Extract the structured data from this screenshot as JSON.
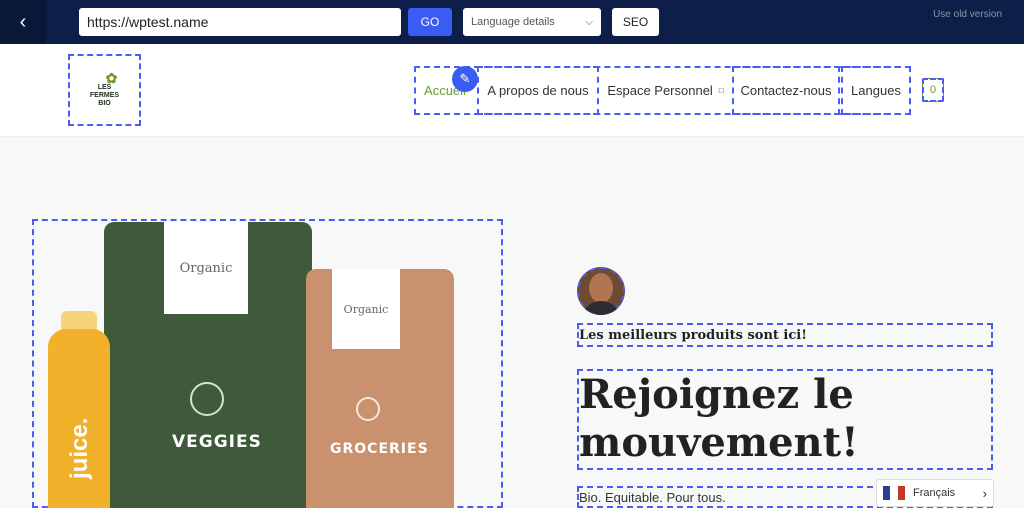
{
  "toolbar": {
    "back_icon": "chevron-left-icon",
    "url_value": "https://wptest.name",
    "go_label": "GO",
    "language_select": "Language details",
    "seo_label": "SEO",
    "old_version_link": "Use old version",
    "accent_color": "#3b5bf5",
    "bar_color": "#0d1f48"
  },
  "site": {
    "logo_lines": [
      "LES",
      "FERMES",
      "BIO"
    ],
    "nav": [
      "Accueil",
      "A propos de nous",
      "Espace Personnel",
      "Contactez-nous",
      "Langues"
    ],
    "nav_active_color": "#6b9a2e",
    "cart_count": "0"
  },
  "hero": {
    "pouch_green_label": "Organic",
    "pouch_green_name": "VEGGIES",
    "pouch_brown_label": "Organic",
    "pouch_brown_name": "GROCERIES",
    "bottle_text": "juice.",
    "tagline": "Les meilleurs produits sont ici!",
    "headline_line1": "Rejoignez le",
    "headline_line2": "mouvement!",
    "subtitle": "Bio. Equitable. Pour tous."
  },
  "language_switcher": {
    "label": "Français",
    "flag": [
      "#2c3e91",
      "#ffffff",
      "#c0392b"
    ]
  }
}
